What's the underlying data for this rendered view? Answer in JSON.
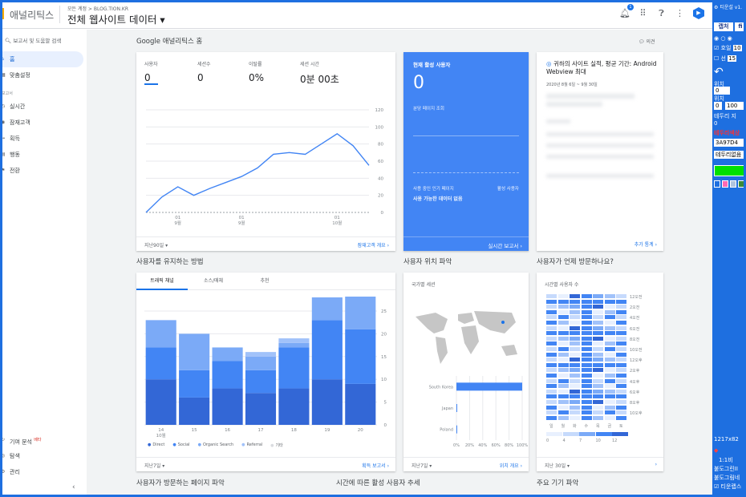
{
  "header": {
    "app_name": "애널리틱스",
    "account_sub": "모든 계정 > BLOG.TION.KR",
    "account_main": "전체 웹사이트 데이터 ▾",
    "notif_count": "1"
  },
  "sidebar": {
    "search": "보고서 및 도움말 검색",
    "items": [
      {
        "label": "홈",
        "icon": "home-icon"
      },
      {
        "label": "맞춤설정",
        "icon": "custom-icon"
      }
    ],
    "section": "보고서",
    "reports": [
      {
        "label": "실시간",
        "icon": "clock-icon"
      },
      {
        "label": "잠재고객",
        "icon": "person-icon"
      },
      {
        "label": "획득",
        "icon": "acquisition-icon"
      },
      {
        "label": "행동",
        "icon": "behavior-icon"
      },
      {
        "label": "전환",
        "icon": "flag-icon"
      }
    ],
    "bottom": [
      {
        "label": "기여 분석",
        "badge": "베타"
      },
      {
        "label": "탐색"
      },
      {
        "label": "관리"
      }
    ]
  },
  "main": {
    "page_title": "Google 애널리틱스 홈",
    "feedback": "의견"
  },
  "overview": {
    "metrics": [
      {
        "label": "사용자",
        "value": "0"
      },
      {
        "label": "세션수",
        "value": "0"
      },
      {
        "label": "이탈률",
        "value": "0%"
      },
      {
        "label": "세션 시간",
        "value": "0분 00초"
      }
    ],
    "foot_left": "지난90일 ▾",
    "foot_right": "잠재고객 개요 ›",
    "x_ticks": [
      "01\n9월",
      "01\n9월",
      "01\n10월"
    ],
    "y_ticks": [
      "120",
      "100",
      "80",
      "60",
      "40",
      "20",
      "0"
    ]
  },
  "chart_data": [
    {
      "type": "line",
      "y": [
        0,
        18,
        30,
        20,
        28,
        35,
        42,
        52,
        68,
        70,
        68,
        80,
        92,
        78,
        55
      ],
      "ylim": [
        0,
        120
      ],
      "xlabels": [
        "01 9월",
        "01 9월",
        "01 10월"
      ]
    },
    {
      "type": "bar",
      "categories": [
        "14",
        "15",
        "16",
        "17",
        "18",
        "19",
        "20"
      ],
      "xlabel_sub": "10월",
      "series": [
        {
          "name": "Direct",
          "values": [
            10,
            6,
            8,
            7,
            8,
            10,
            9
          ]
        },
        {
          "name": "Social",
          "values": [
            7,
            6,
            6,
            5,
            9,
            13,
            12
          ]
        },
        {
          "name": "Organic Search",
          "values": [
            6,
            8,
            3,
            3,
            1,
            5,
            10
          ]
        },
        {
          "name": "Referral",
          "values": [
            0,
            0,
            0,
            1,
            1,
            0,
            0
          ]
        }
      ],
      "ylim": [
        0,
        25
      ],
      "yticks": [
        "25",
        "20",
        "15",
        "10",
        "5",
        "0"
      ]
    },
    {
      "type": "bar",
      "orientation": "horizontal",
      "categories": [
        "South Korea",
        "Japan",
        "Poland"
      ],
      "values": [
        100,
        1,
        1
      ],
      "xticks": [
        "0%",
        "20%",
        "40%",
        "60%",
        "80%",
        "100%"
      ]
    }
  ],
  "realtime": {
    "title": "현재 활성 사용자",
    "value": "0",
    "sub1": "분당 페이지 조회",
    "sub2": "사용 중인 인기 페이지",
    "sub2r": "활성 사용자",
    "sub3": "사용 가능한 데이터 없음",
    "foot": "실시간 보고서 ›"
  },
  "insights": {
    "title": "귀하의 사이트 실적, 평균 기간: Android Webview 최대",
    "date": "2020년 8월 6일 ~ 9월 30일",
    "foot": "추가 통계 ›"
  },
  "sections": {
    "retain": "사용자를 유지하는 방법",
    "location": "사용자 위치 파악",
    "when": "사용자가 언제 방문하나요?",
    "pages": "사용자가 방문하는 페이지 파악",
    "active": "시간에 따른 활성 사용자 추세",
    "device": "주요 기기 파악"
  },
  "retain_card": {
    "tabs": [
      "트래픽 채널",
      "소스/매체",
      "추천"
    ],
    "legend": [
      "Direct",
      "Social",
      "Organic Search",
      "Referral",
      "기타"
    ],
    "foot_left": "지난7일 ▾",
    "foot_right": "획득 보고서 ›"
  },
  "geo_card": {
    "title": "국가별 세션",
    "foot_left": "지난7일 ▾",
    "foot_right": "위치 개요 ›"
  },
  "time_card": {
    "title": "시간별 사용자 수",
    "hours": [
      "12오전",
      "2오전",
      "4오전",
      "6오전",
      "8오전",
      "10오전",
      "12오후",
      "2오후",
      "4오후",
      "6오후",
      "8오후",
      "10오후"
    ],
    "days": [
      "일",
      "월",
      "화",
      "수",
      "목",
      "금",
      "토"
    ],
    "scale": [
      "0",
      "4",
      "7",
      "10",
      "12"
    ],
    "foot_left": "지난 30일 ▾"
  },
  "tool": {
    "top": "티운설",
    "ver": "v1.",
    "capture": "캡처",
    "fi": "fi",
    "r1": "호일",
    "v10": "10",
    "sun": "선",
    "v15": "15",
    "lbl1": "위치",
    "lbl2": "위치",
    "v0a": "0",
    "v0b": "0",
    "v0c": "0",
    "v100": "100",
    "v100b": "100",
    "label3": "테두리 지",
    "v0d": "0",
    "label4": "테두리색상",
    "color": "3A97D4",
    "border": "테두리없음",
    "size": "1217x82",
    "scale": "1:1비",
    "t1": "붙도그린II",
    "t2": "붙도그림네",
    "t3": "티운랩스"
  }
}
